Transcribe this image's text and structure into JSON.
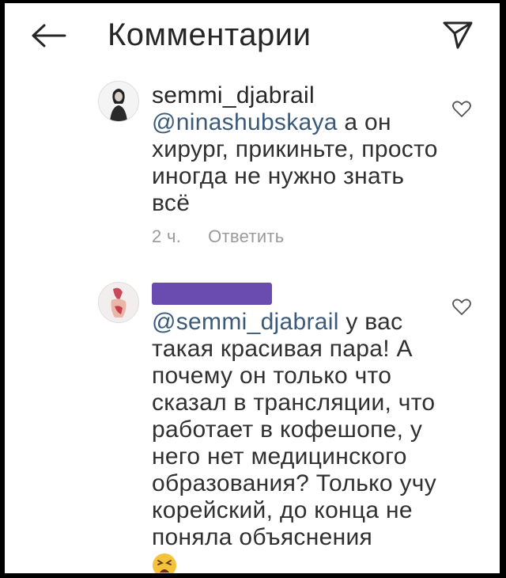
{
  "header": {
    "title": "Комментарии",
    "back_icon": "arrow-left-icon",
    "send_icon": "send-icon"
  },
  "comments": [
    {
      "username": "semmi_djabrail",
      "mention": "@ninashubskaya",
      "text": " а он хирург, прикиньте, просто иногда не нужно знать всё",
      "time": "2 ч.",
      "reply_label": "Ответить"
    },
    {
      "username_redacted": true,
      "mention": "@semmi_djabrail",
      "text": " у вас такая красивая пара! А почему он только что сказал в трансляции, что работает в кофешопе, у него нет медицинского образования? Только учу корейский, до конца не поняла объяснения",
      "emoji": "tired-face-emoji"
    }
  ],
  "colors": {
    "mention": "#3b5a79",
    "redaction": "#6a4cb0",
    "meta": "#9a9a9a"
  }
}
